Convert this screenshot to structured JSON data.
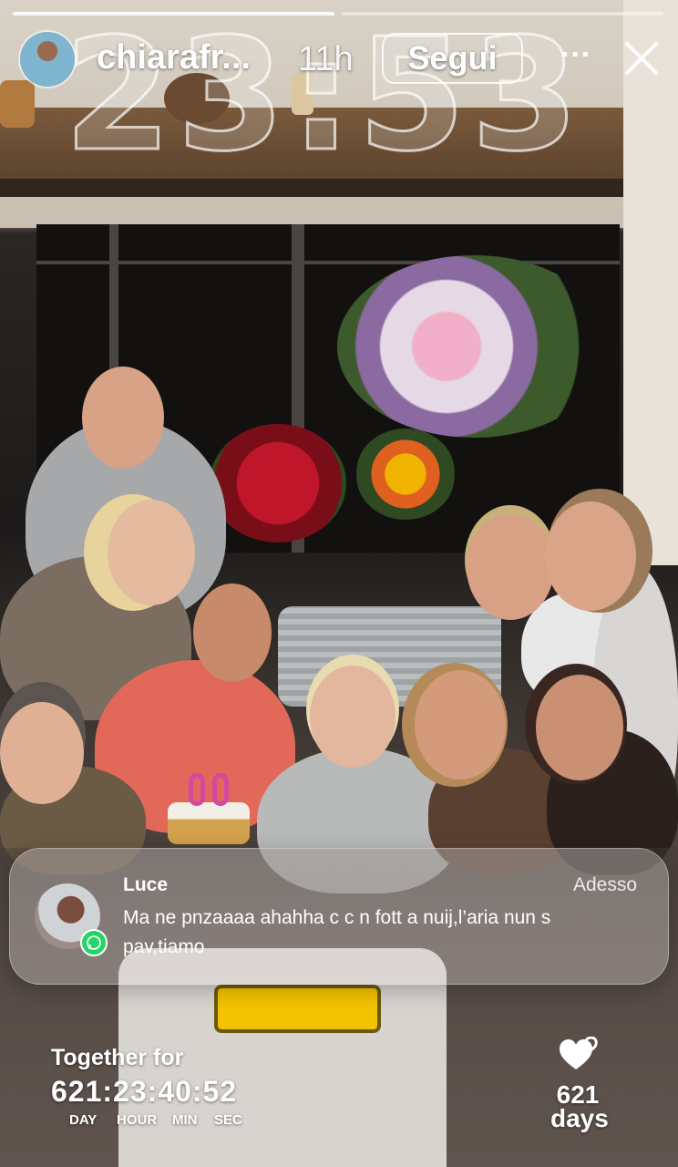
{
  "story": {
    "username": "chiarafr...",
    "time_ago": "11h",
    "follow_label": "Segui",
    "more_icon": "ellipsis-icon",
    "close_icon": "close-icon",
    "progress_segments": 2,
    "clock_overlay": "23:53"
  },
  "photo": {
    "cake_candles": "80"
  },
  "notification": {
    "sender": "Luce",
    "time": "Adesso",
    "message": "Ma ne pnzaaaa ahahha c c n fott a nuij,l’aria nun s pav,tiamo",
    "app_icon": "whatsapp-icon"
  },
  "counter": {
    "label": "Together for",
    "value": "621:23:40:52",
    "units": [
      "DAY",
      "HOUR",
      "MIN",
      "SEC"
    ],
    "days_number": "621",
    "days_label": "days",
    "heart_icon": "hearts-icon"
  },
  "colors": {
    "follow_border": "#ffffff",
    "whatsapp_green": "#25d366",
    "candle_pink": "#d04aa0"
  }
}
